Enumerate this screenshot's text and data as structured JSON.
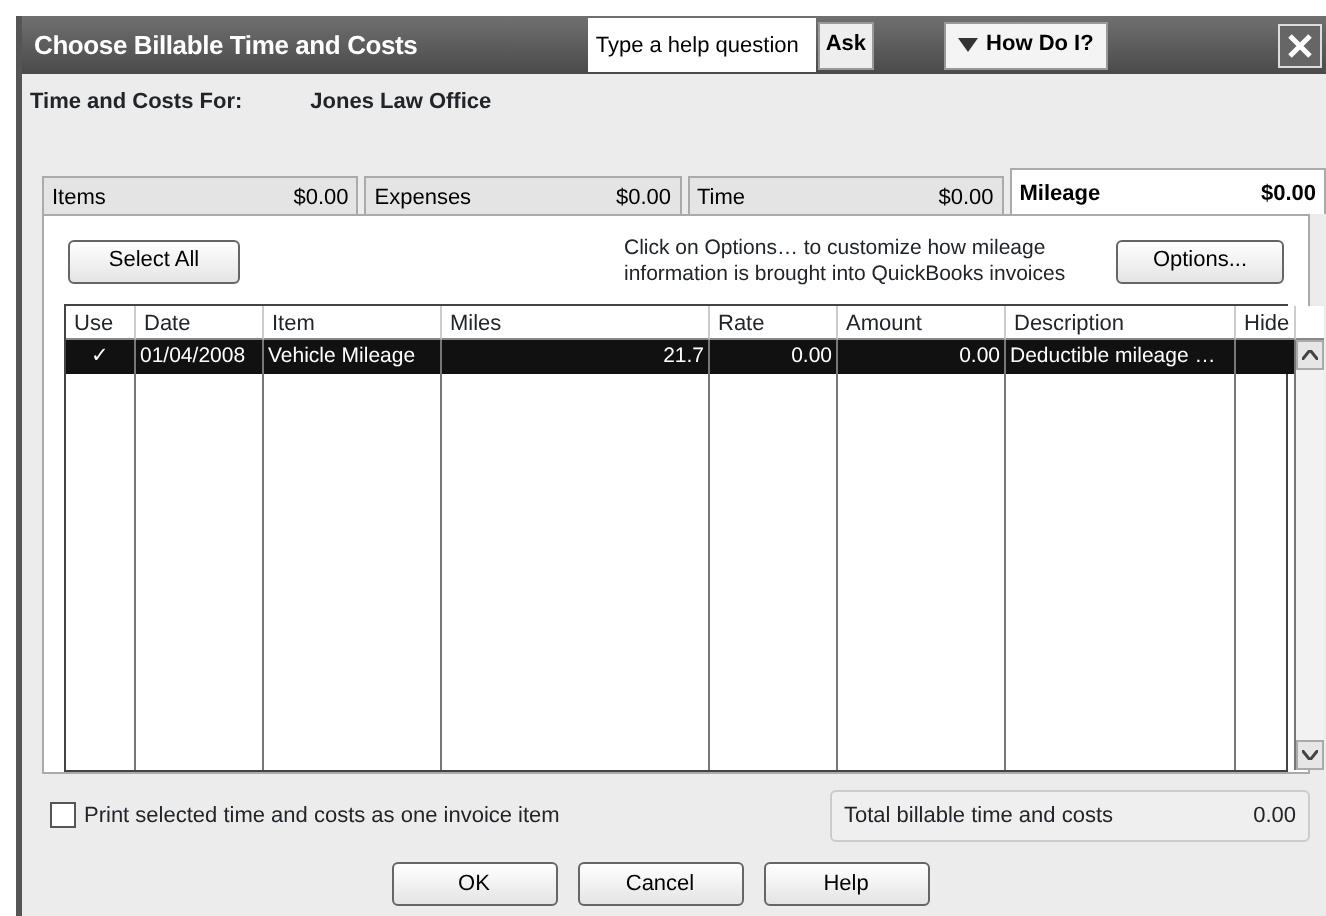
{
  "window": {
    "title": "Choose Billable Time and Costs"
  },
  "help": {
    "placeholder": "Type a help question",
    "ask": "Ask",
    "how_do_i": "How Do I?"
  },
  "for": {
    "label": "Time and Costs For:",
    "value": "Jones Law Office"
  },
  "tabs": [
    {
      "label": "Items",
      "amount": "$0.00",
      "selected": false
    },
    {
      "label": "Expenses",
      "amount": "$0.00",
      "selected": false
    },
    {
      "label": "Time",
      "amount": "$0.00",
      "selected": false
    },
    {
      "label": "Mileage",
      "amount": "$0.00",
      "selected": true
    }
  ],
  "select_all": "Select All",
  "hint": "Click on Options… to customize how mileage information is brought into QuickBooks invoices",
  "options": "Options...",
  "table": {
    "columns": [
      "Use",
      "Date",
      "Item",
      "Miles",
      "Rate",
      "Amount",
      "Description",
      "Hide"
    ],
    "rows": [
      {
        "use": "✓",
        "date": "01/04/2008",
        "item": "Vehicle Mileage",
        "miles": "21.7",
        "rate": "0.00",
        "amount": "0.00",
        "description": "Deductible mileage …",
        "selected": true
      }
    ]
  },
  "print_one": {
    "label": "Print selected time and costs as one invoice item",
    "checked": false
  },
  "total": {
    "label": "Total billable time and costs",
    "value": "0.00"
  },
  "buttons": [
    "OK",
    "Cancel",
    "Help"
  ]
}
